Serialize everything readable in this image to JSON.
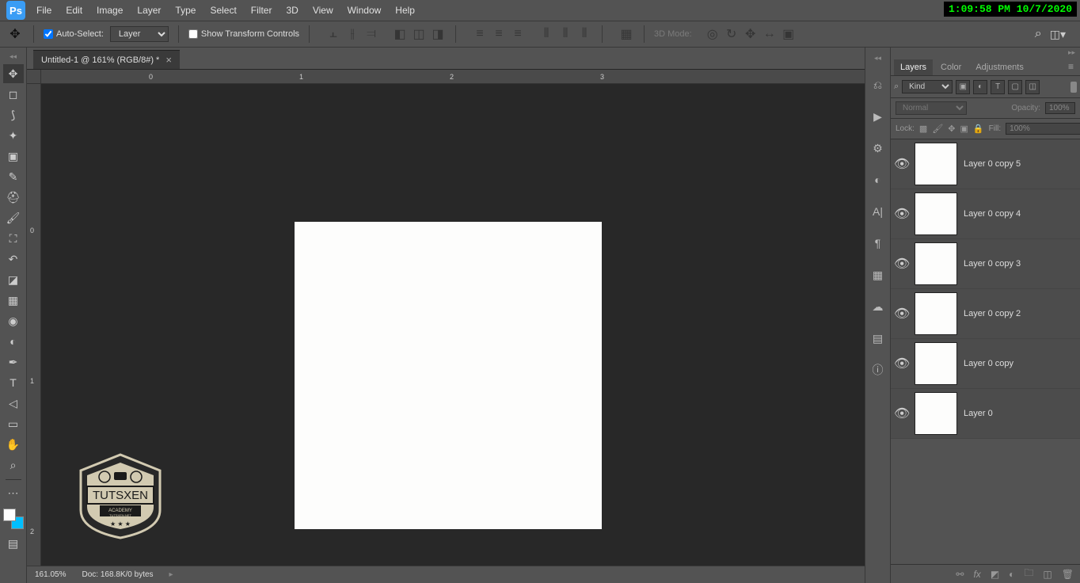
{
  "timestamp": "1:09:58 PM 10/7/2020",
  "menu": [
    "File",
    "Edit",
    "Image",
    "Layer",
    "Type",
    "Select",
    "Filter",
    "3D",
    "View",
    "Window",
    "Help"
  ],
  "options": {
    "auto_select_label": "Auto-Select:",
    "auto_select_target": "Layer",
    "show_transform_label": "Show Transform Controls",
    "mode_3d_label": "3D Mode:"
  },
  "document": {
    "tab_title": "Untitled-1 @ 161% (RGB/8#) *",
    "ruler_h": [
      "0",
      "1",
      "2",
      "3"
    ],
    "ruler_v": [
      "0",
      "1",
      "2"
    ]
  },
  "status": {
    "zoom": "161.05%",
    "doc_info": "Doc: 168.8K/0 bytes"
  },
  "panels": {
    "tabs": [
      "Layers",
      "Color",
      "Adjustments"
    ],
    "filter_label": "Kind",
    "blend_mode": "Normal",
    "opacity_label": "Opacity:",
    "opacity_value": "100%",
    "lock_label": "Lock:",
    "fill_label": "Fill:",
    "fill_value": "100%",
    "layers": [
      {
        "name": "Layer 0 copy 5"
      },
      {
        "name": "Layer 0 copy 4"
      },
      {
        "name": "Layer 0 copy 3"
      },
      {
        "name": "Layer 0 copy 2"
      },
      {
        "name": "Layer 0 copy"
      },
      {
        "name": "Layer 0"
      }
    ]
  },
  "watermark": {
    "line1": "TUTSXEN",
    "line2": "ACADEMY",
    "line3": "TUTSXEN.NET"
  }
}
